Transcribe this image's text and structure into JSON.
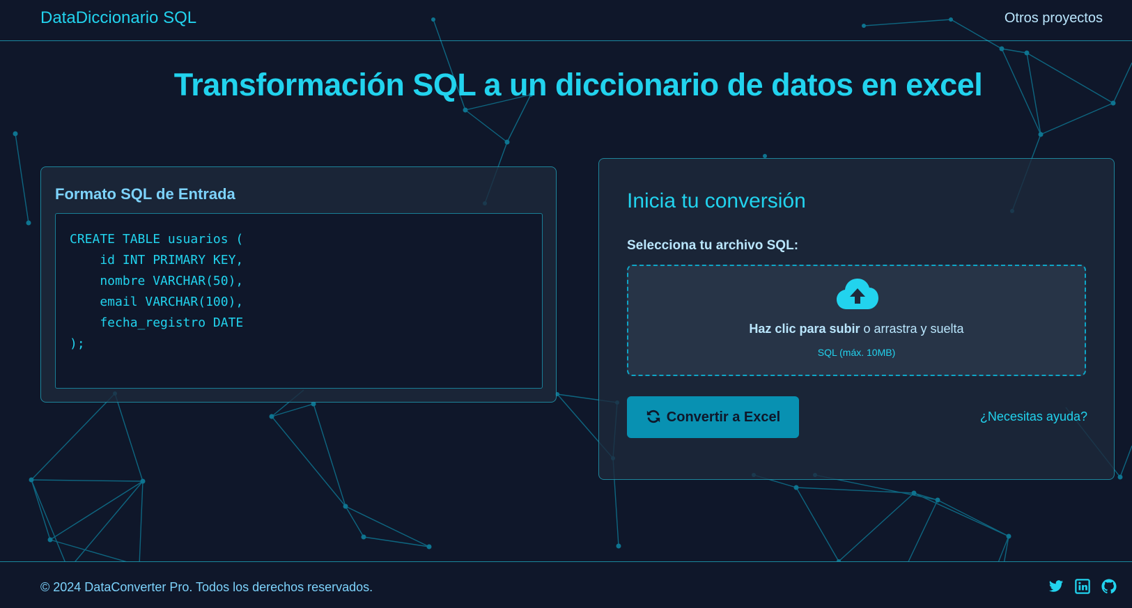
{
  "colors": {
    "background": "#0f172a",
    "accent": "#22d3ee",
    "panel": "#1e293b",
    "button": "#0891b2"
  },
  "header": {
    "brand": "DataDiccionario SQL",
    "nav_link": "Otros proyectos"
  },
  "main": {
    "title": "Transformación SQL a un diccionario de datos en excel"
  },
  "input_panel": {
    "title": "Formato SQL de Entrada",
    "code_lines": [
      "CREATE TABLE usuarios (",
      "    id INT PRIMARY KEY,",
      "    nombre VARCHAR(50),",
      "    email VARCHAR(100),",
      "    fecha_registro DATE",
      ");"
    ]
  },
  "convert_panel": {
    "title": "Inicia tu conversión",
    "file_label": "Selecciona tu archivo SQL:",
    "dropzone": {
      "icon": "cloud-upload-icon",
      "click_text": "Haz clic para subir",
      "drag_text": " o arrastra y suelta",
      "hint": "SQL (máx. 10MB)"
    },
    "convert_button": {
      "icon": "refresh-icon",
      "label": "Convertir a Excel"
    },
    "help_link": "¿Necesitas ayuda?"
  },
  "footer": {
    "copyright": "© 2024 DataConverter Pro. Todos los derechos reservados.",
    "social_icons": [
      "twitter-icon",
      "linkedin-icon",
      "github-icon"
    ]
  }
}
